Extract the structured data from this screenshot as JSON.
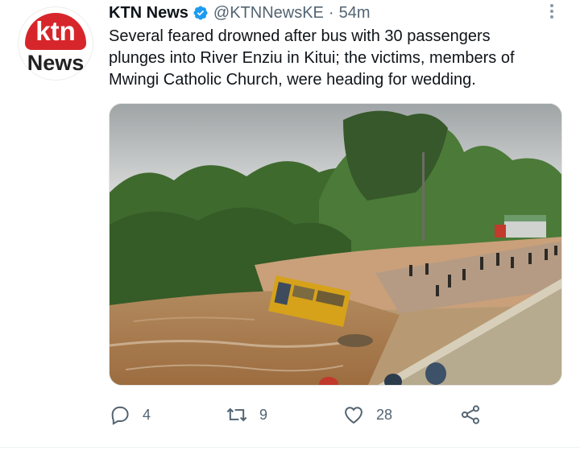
{
  "account": {
    "name": "KTN News",
    "handle": "@KTNNewsKE",
    "separator": "·",
    "time": "54m",
    "avatar_logo_top": "ktn",
    "avatar_logo_bottom": "News",
    "verified": true
  },
  "tweet": {
    "lines": [
      "Several feared drowned after bus with 30 passengers",
      "plunges into River Enziu in Kitui; the victims, members of",
      "Mwingi Catholic Church, were heading for wedding."
    ]
  },
  "actions": {
    "reply_count": "4",
    "retweet_count": "9",
    "like_count": "28"
  },
  "colors": {
    "text": "#0f1419",
    "secondary": "#536471",
    "verified": "#1d9bf0",
    "brand_red": "#d7262b"
  },
  "icons": [
    "verified-badge-icon",
    "more-icon",
    "reply-icon",
    "retweet-icon",
    "like-icon",
    "share-icon"
  ]
}
